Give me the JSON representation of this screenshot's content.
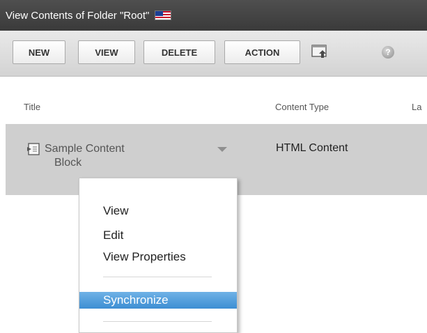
{
  "window": {
    "title": "View Contents of Folder \"Root\""
  },
  "toolbar": {
    "new": "NEW",
    "view": "VIEW",
    "delete": "DELETE",
    "action": "ACTION"
  },
  "columns": {
    "title": "Title",
    "content_type": "Content Type",
    "last": "La"
  },
  "row": {
    "title_line1": "Sample Content",
    "title_line2": "Block",
    "content_type": "HTML Content"
  },
  "context_menu": {
    "view": "View",
    "edit": "Edit",
    "view_properties": "View Properties",
    "synchronize": "Synchronize"
  },
  "icons": {
    "flag": "us-flag-icon",
    "toolbar": "upload-icon",
    "help": "help-icon",
    "item": "content-block-icon",
    "dropdown": "chevron-down-icon"
  },
  "colors": {
    "titlebar": "#444444",
    "selected_row": "#cfcfcf",
    "menu_highlight": "#3d8ed3"
  }
}
